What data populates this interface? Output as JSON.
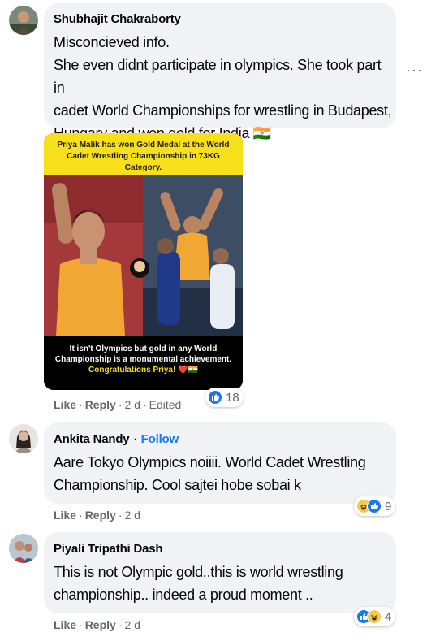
{
  "comments": [
    {
      "author": "Shubhajit Chakraborty",
      "lines": [
        "Misconcieved info.",
        "She even didnt participate in olympics. She took part in",
        "cadet World Championships for wrestling in Budapest,",
        "Hungary and won gold for India 🇮🇳"
      ],
      "actions": {
        "like": "Like",
        "reply": "Reply",
        "time": "2 d",
        "edited": "Edited"
      },
      "reactions": {
        "count": "18"
      },
      "more_label": "···",
      "attachment": {
        "banner": "Priya Malik has won Gold Medal at the World Cadet Wrestling Championship in 73KG Category.",
        "caption_line1": "It isn't Olympics but gold in any World",
        "caption_line2": "Championship is a monumental achievement.",
        "caption_line3": "Congratulations Priya! ❤️🇮🇳"
      }
    },
    {
      "author": "Ankita Nandy",
      "follow": "Follow",
      "lines": [
        "Aare Tokyo Olympics noiiii. World Cadet Wrestling",
        "Championship. Cool sajtei hobe sobai k"
      ],
      "actions": {
        "like": "Like",
        "reply": "Reply",
        "time": "2 d"
      },
      "reactions": {
        "count": "9"
      }
    },
    {
      "author": "Piyali Tripathi Dash",
      "lines": [
        "This is not Olympic gold..this is world wrestling",
        "championship.. indeed a proud moment .."
      ],
      "actions": {
        "like": "Like",
        "reply": "Reply",
        "time": "2 d"
      },
      "reactions": {
        "count": "4"
      }
    }
  ],
  "colors": {
    "bubble": "#f0f2f5",
    "link": "#1877f2",
    "meta": "#65676b",
    "banner": "#f7e01b"
  }
}
